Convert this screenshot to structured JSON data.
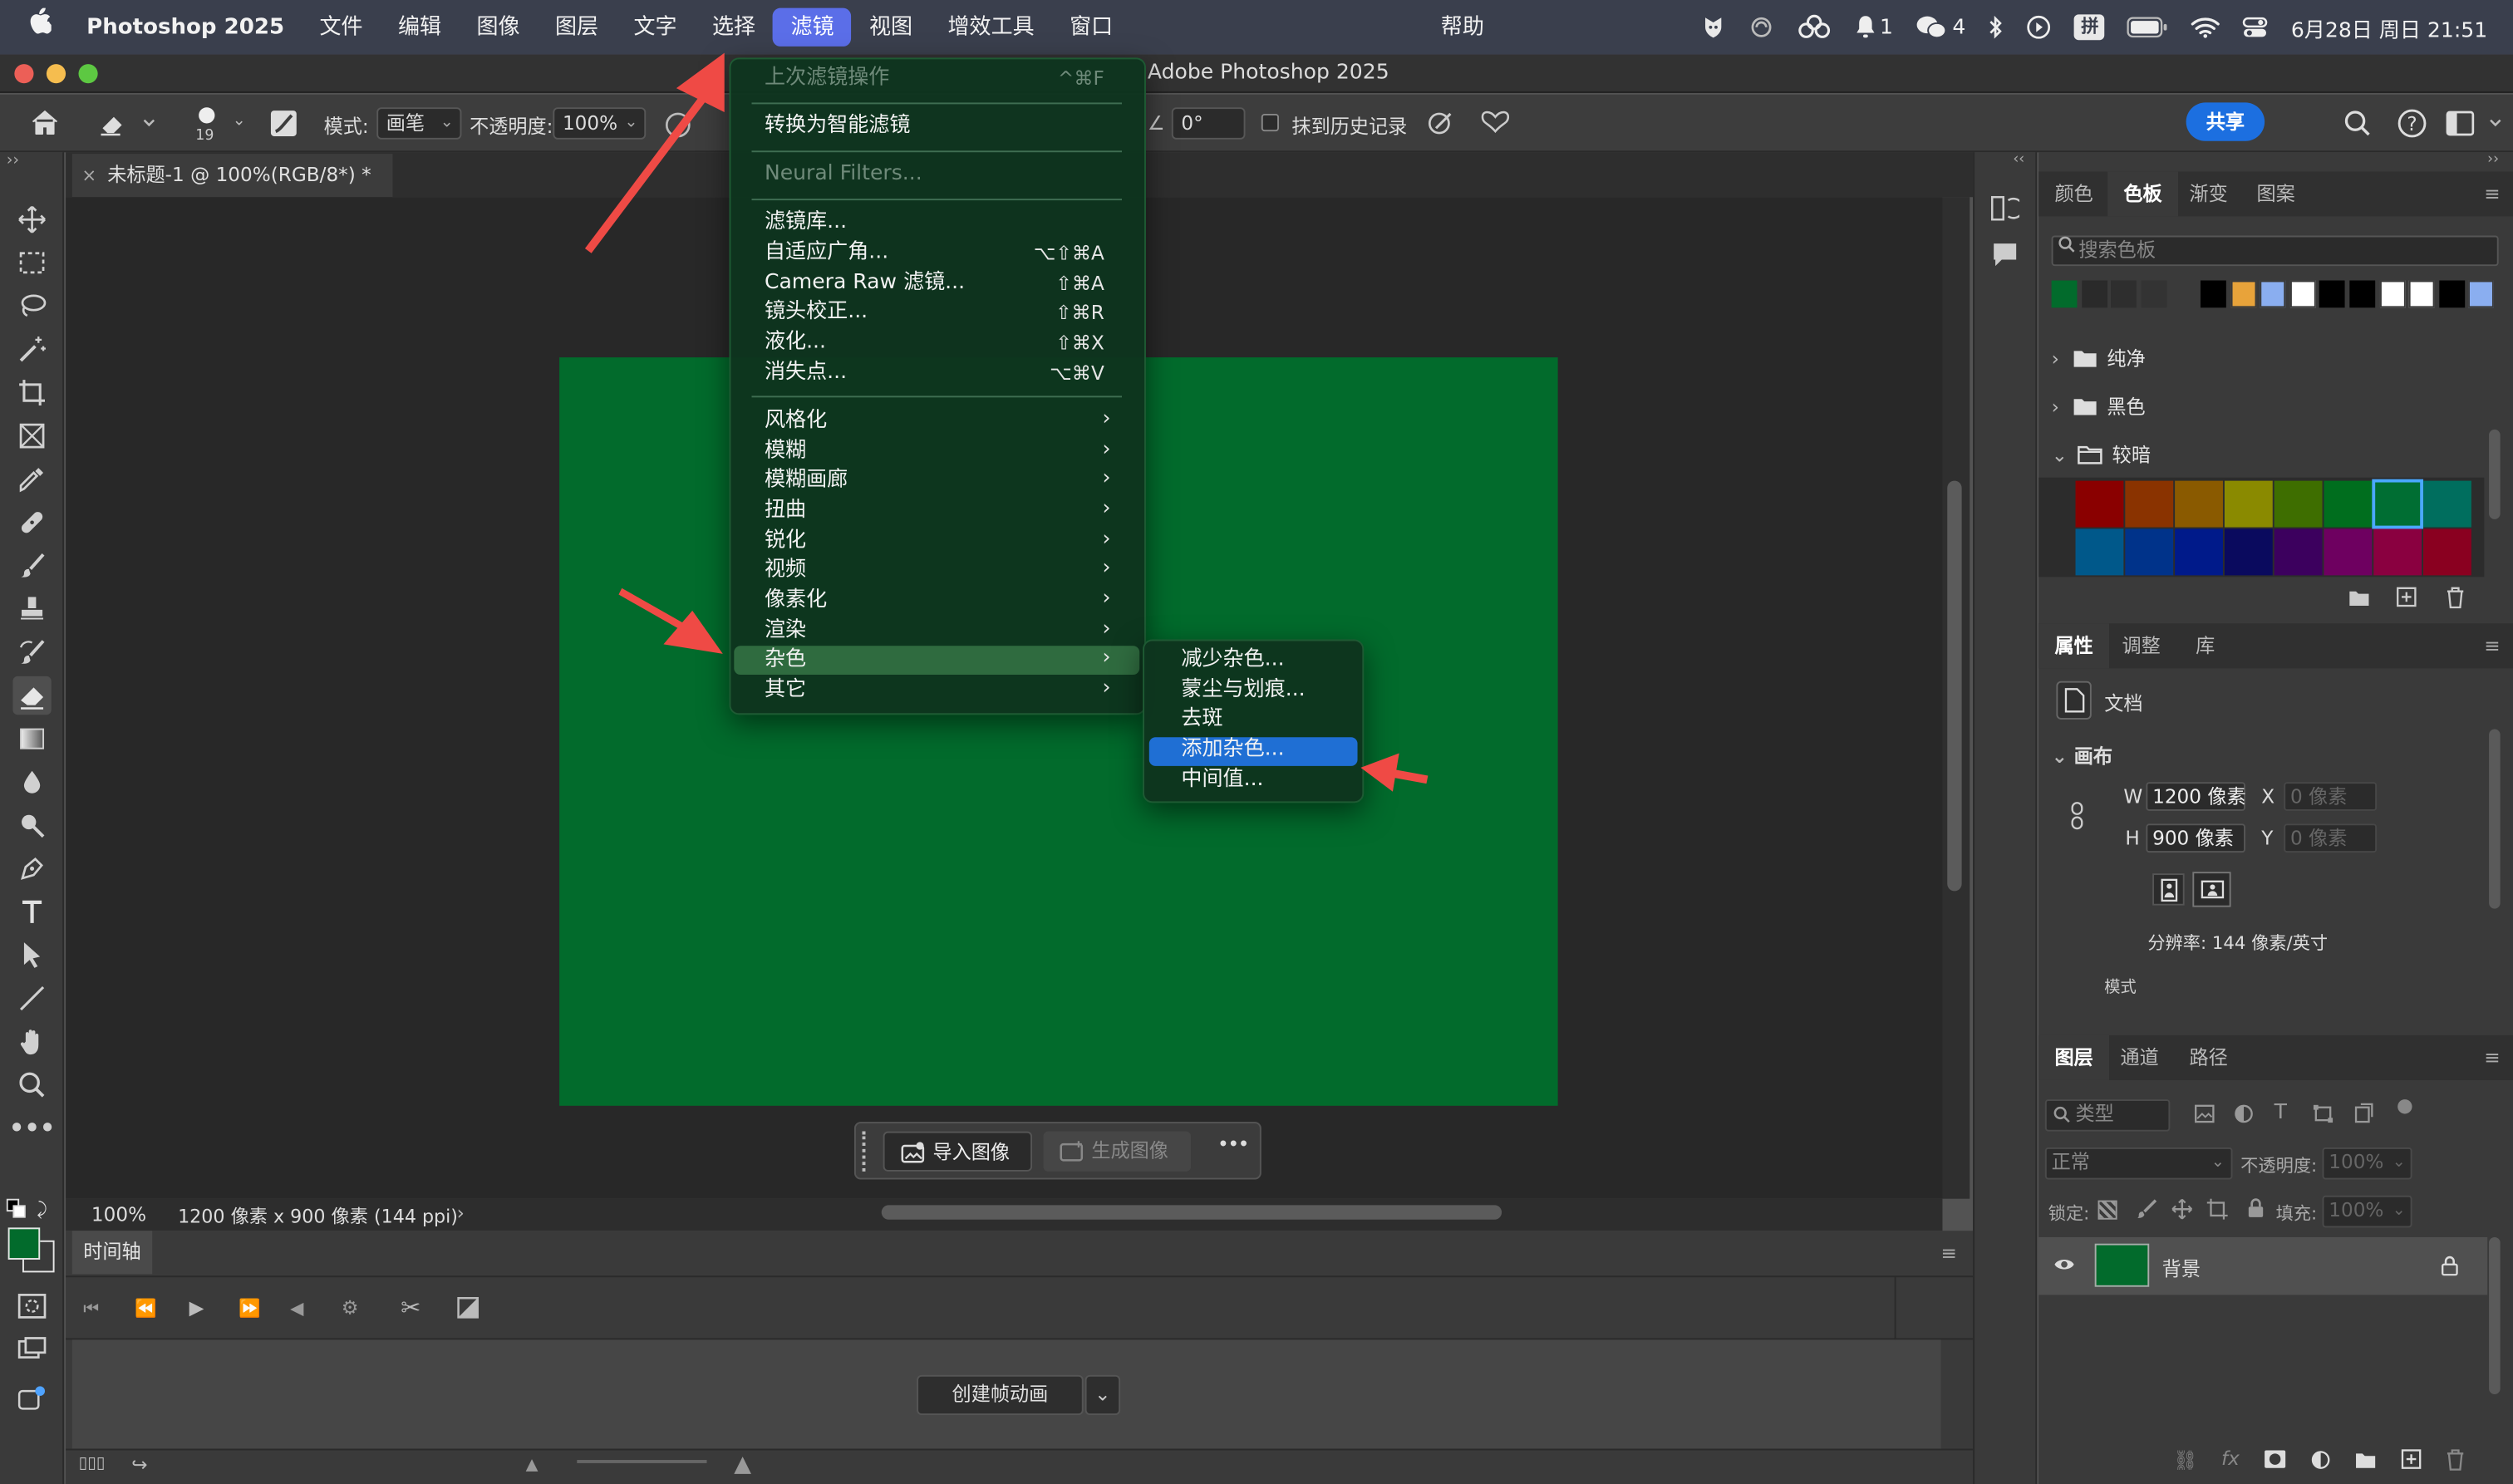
{
  "menubar": {
    "apple": "",
    "app_name": "Photoshop 2025",
    "items": [
      "文件",
      "编辑",
      "图像",
      "图层",
      "文字",
      "选择",
      "滤镜",
      "视图",
      "增效工具",
      "窗口"
    ],
    "help": "帮助",
    "status": {
      "notif_count": "1",
      "wechat_count": "4",
      "ime": "拼",
      "datetime": "6月28日 周日 21:51"
    }
  },
  "window": {
    "title": "Adobe Photoshop 2025"
  },
  "options_bar": {
    "brush_size": "19",
    "mode_label": "模式:",
    "mode_value": "画笔",
    "opacity_label": "不透明度:",
    "opacity_value": "100%",
    "angle_value": "0°",
    "history_label": "抹到历史记录",
    "share": "共享"
  },
  "document": {
    "tab_title": "未标题-1 @ 100%(RGB/8*) *",
    "zoom": "100%",
    "info": "1200 像素 x 900 像素 (144 ppi)",
    "canvas_color": "#026b2c"
  },
  "taskbar": {
    "import": "导入图像",
    "generate": "生成图像",
    "more": "•••"
  },
  "filter_menu": {
    "items": [
      {
        "label": "上次滤镜操作",
        "shortcut": "^⌘F",
        "disabled": true
      },
      {
        "label": "转换为智能滤镜",
        "shortcut": ""
      },
      {
        "label": "Neural Filters...",
        "shortcut": "",
        "disabled": true
      },
      {
        "label": "滤镜库...",
        "shortcut": ""
      },
      {
        "label": "自适应广角...",
        "shortcut": "⌥⇧⌘A"
      },
      {
        "label": "Camera Raw 滤镜...",
        "shortcut": "⇧⌘A"
      },
      {
        "label": "镜头校正...",
        "shortcut": "⇧⌘R"
      },
      {
        "label": "液化...",
        "shortcut": "⇧⌘X"
      },
      {
        "label": "消失点...",
        "shortcut": "⌥⌘V"
      },
      {
        "label": "风格化",
        "submenu": true
      },
      {
        "label": "模糊",
        "submenu": true
      },
      {
        "label": "模糊画廊",
        "submenu": true
      },
      {
        "label": "扭曲",
        "submenu": true
      },
      {
        "label": "锐化",
        "submenu": true
      },
      {
        "label": "视频",
        "submenu": true
      },
      {
        "label": "像素化",
        "submenu": true
      },
      {
        "label": "渲染",
        "submenu": true
      },
      {
        "label": "杂色",
        "submenu": true,
        "highlighted": true
      },
      {
        "label": "其它",
        "submenu": true
      }
    ]
  },
  "noise_submenu": {
    "items": [
      "减少杂色...",
      "蒙尘与划痕...",
      "去斑",
      "添加杂色...",
      "中间值..."
    ],
    "highlighted": "添加杂色..."
  },
  "timeline": {
    "tab": "时间轴",
    "create_button": "创建帧动画"
  },
  "swatches_panel": {
    "tabs": [
      "颜色",
      "色板",
      "渐变",
      "图案"
    ],
    "active_tab": "色板",
    "search_placeholder": "搜索色板",
    "recent": [
      "#026b2c",
      "#2a2a2a",
      "#2e2e2e",
      "#333333",
      "#3a3a3a",
      "#000000",
      "#e8a33a",
      "#8aaef0",
      "#ffffff",
      "#000000",
      "#000000",
      "#ffffff",
      "#ffffff",
      "#000000",
      "#8aaef0"
    ],
    "groups": [
      "纯净",
      "黑色",
      "较暗"
    ],
    "dark_colors": [
      "#8a0000",
      "#8a3300",
      "#8a5a00",
      "#8a8a00",
      "#3e6e00",
      "#006e1e",
      "#006e33",
      "#006e5e",
      "#00588a",
      "#00338a",
      "#001a8a",
      "#0a0a5e",
      "#3c005e",
      "#6e0060",
      "#8a0040",
      "#8a0020"
    ]
  },
  "properties_panel": {
    "tabs": [
      "属性",
      "调整",
      "库"
    ],
    "active_tab": "属性",
    "doc_label": "文档",
    "canvas_section": "画布",
    "w_label": "W",
    "w_value": "1200 像素",
    "h_label": "H",
    "h_value": "900 像素",
    "x_label": "X",
    "x_value": "0 像素",
    "y_label": "Y",
    "y_value": "0 像素",
    "resolution": "分辨率: 144 像素/英寸",
    "mode_label": "模式"
  },
  "layers_panel": {
    "tabs": [
      "图层",
      "通道",
      "路径"
    ],
    "active_tab": "图层",
    "filter_placeholder": "类型",
    "blend_mode": "正常",
    "opacity_label": "不透明度:",
    "opacity_value": "100%",
    "lock_label": "锁定:",
    "fill_label": "填充:",
    "fill_value": "100%",
    "layers": [
      {
        "name": "背景",
        "locked": true,
        "visible": true
      }
    ]
  }
}
